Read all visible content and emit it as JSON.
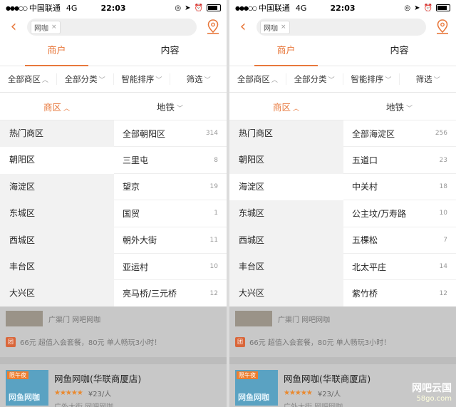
{
  "status": {
    "signal": "●●●○○",
    "carrier": "中国联通",
    "network": "4G",
    "time": "22:03"
  },
  "search": {
    "keyword": "网咖",
    "clear": "×"
  },
  "tabs": [
    "商户",
    "内容"
  ],
  "filters": [
    "全部商区",
    "全部分类",
    "智能排序",
    "筛选"
  ],
  "subtabs": [
    "商区",
    "地铁"
  ],
  "districts": [
    "热门商区",
    "朝阳区",
    "海淀区",
    "东城区",
    "西城区",
    "丰台区",
    "大兴区"
  ],
  "left_panel": {
    "selected_district": "朝阳区",
    "areas": [
      {
        "name": "全部朝阳区",
        "count": "314"
      },
      {
        "name": "三里屯",
        "count": "8"
      },
      {
        "name": "望京",
        "count": "19"
      },
      {
        "name": "国贸",
        "count": "1"
      },
      {
        "name": "朝外大街",
        "count": "11"
      },
      {
        "name": "亚运村",
        "count": "10"
      },
      {
        "name": "亮马桥/三元桥",
        "count": "12"
      }
    ]
  },
  "right_panel": {
    "selected_district": "海淀区",
    "areas": [
      {
        "name": "全部海淀区",
        "count": "256"
      },
      {
        "name": "五道口",
        "count": "23"
      },
      {
        "name": "中关村",
        "count": "18"
      },
      {
        "name": "公主坟/万寿路",
        "count": "10"
      },
      {
        "name": "五棵松",
        "count": "7"
      },
      {
        "name": "北太平庄",
        "count": "14"
      },
      {
        "name": "紫竹桥",
        "count": "12"
      }
    ]
  },
  "background_list": {
    "card1": {
      "meta": "广渠门  网吧网咖",
      "tuan_icon": "团",
      "deal": "66元 超值入会套餐，80元 单人畅玩3小时！"
    },
    "card2": {
      "badge": "限午夜",
      "logo_text": "网鱼网咖",
      "name": "网鱼网咖(华联商厦店)",
      "stars": "★★★★★",
      "price": "¥23/人",
      "location": "广外大街  网吧网咖"
    }
  },
  "watermark": {
    "line1": "网吧云国",
    "line2": "58go.com"
  },
  "colors": {
    "accent": "#e8783c"
  }
}
